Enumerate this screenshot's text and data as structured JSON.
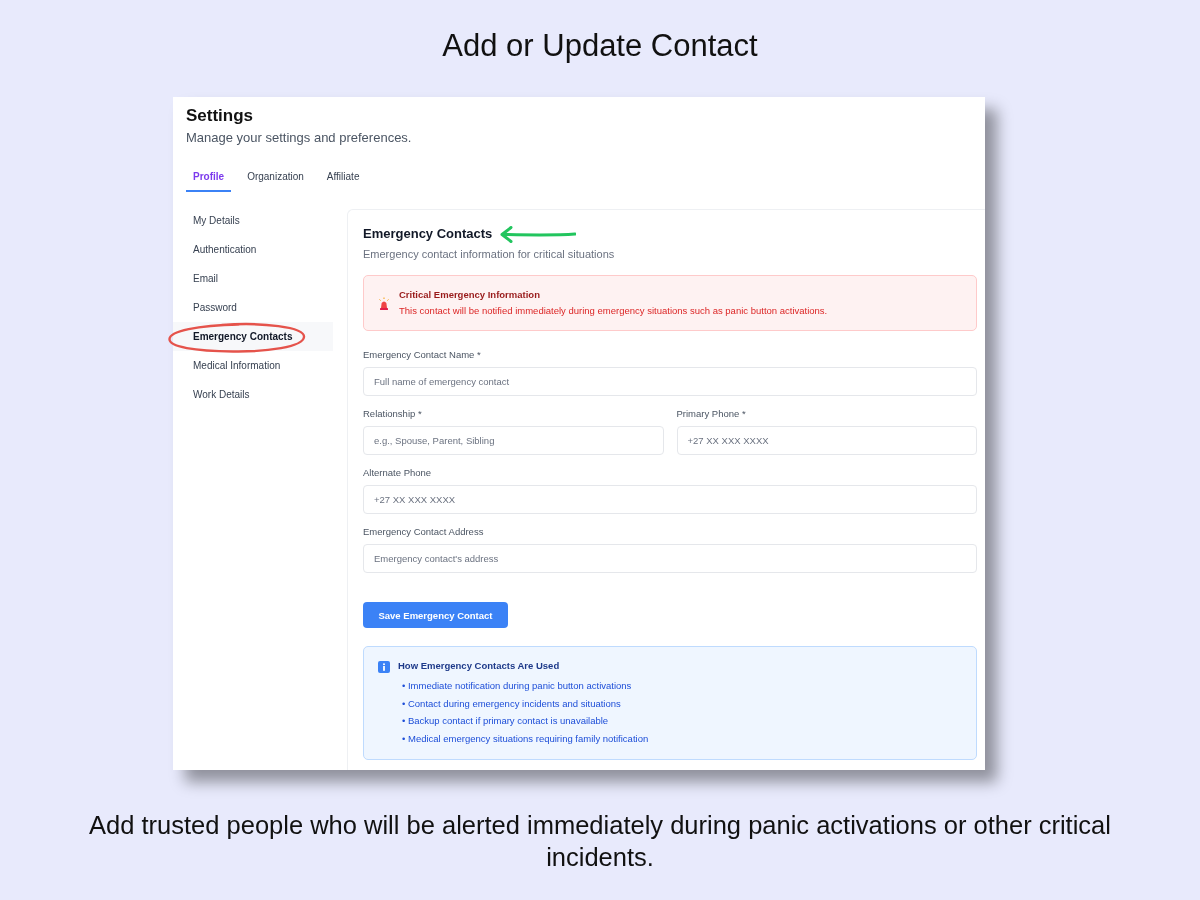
{
  "heading": "Add or Update Contact",
  "settings": {
    "title": "Settings",
    "subtitle": "Manage your settings and preferences.",
    "tabs": [
      {
        "label": "Profile",
        "selected": true
      },
      {
        "label": "Organization",
        "selected": false
      },
      {
        "label": "Affiliate",
        "selected": false
      }
    ]
  },
  "sidebar": {
    "items": [
      {
        "label": "My Details",
        "selected": false,
        "circled": false
      },
      {
        "label": "Authentication",
        "selected": false,
        "circled": false
      },
      {
        "label": "Email",
        "selected": false,
        "circled": false
      },
      {
        "label": "Password",
        "selected": false,
        "circled": false
      },
      {
        "label": "Emergency Contacts",
        "selected": true,
        "circled": true
      },
      {
        "label": "Medical Information",
        "selected": false,
        "circled": false
      },
      {
        "label": "Work Details",
        "selected": false,
        "circled": false
      }
    ]
  },
  "section": {
    "title": "Emergency Contacts",
    "arrow": true,
    "subtitle": "Emergency contact information for critical situations",
    "alert": {
      "title": "Critical Emergency Information",
      "text": "This contact will be notified immediately during emergency situations such as panic button activations."
    },
    "form_rows": [
      {
        "fields": [
          {
            "label": "Emergency Contact Name *",
            "placeholder": "Full name of emergency contact"
          }
        ]
      },
      {
        "fields": [
          {
            "label": "Relationship *",
            "placeholder": "e.g., Spouse, Parent, Sibling"
          },
          {
            "label": "Primary Phone *",
            "placeholder": "+27 XX XXX XXXX"
          }
        ]
      },
      {
        "fields": [
          {
            "label": "Alternate Phone",
            "placeholder": "+27 XX XXX XXXX"
          }
        ]
      },
      {
        "fields": [
          {
            "label": "Emergency Contact Address",
            "placeholder": "Emergency contact's address"
          }
        ]
      }
    ],
    "save_button": {
      "label": "Save Emergency Contact"
    },
    "info": {
      "title": "How Emergency Contacts Are Used",
      "items": [
        "• Immediate notification during panic button activations",
        "• Contact during emergency incidents and situations",
        "• Backup contact if primary contact is unavailable",
        "• Medical emergency situations requiring family notification"
      ]
    }
  },
  "caption": "Add trusted people who will be alerted immediately during panic activations or other critical incidents."
}
